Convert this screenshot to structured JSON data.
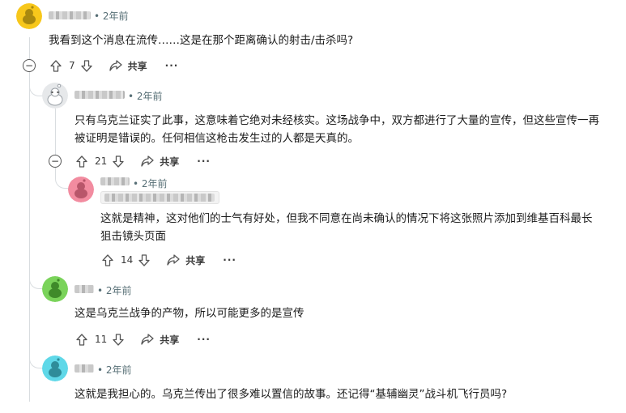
{
  "comments": [
    {
      "time": "2年前",
      "text": "我看到这个消息在流传……这是在那个距离确认的射击/击杀吗?",
      "votes": "7",
      "share": "共享",
      "avatar_color": "#f7c71b"
    },
    {
      "time": "2年前",
      "text": "只有乌克兰证实了此事，这意味着它绝对未经核实。这场战争中，双方都进行了大量的宣传，但这些宣传一再被证明是错误的。任何相信这枪击发生过的人都是天真的。",
      "votes": "21",
      "share": "共享",
      "avatar_color": "#d6d9dc"
    },
    {
      "time": "2年前",
      "text": "这就是精神，这对他们的士气有好处，但我不同意在尚未确认的情况下将这张照片添加到维基百科最长狙击镜头页面",
      "votes": "14",
      "share": "共享",
      "avatar_color": "#f28ca0"
    },
    {
      "time": "2年前",
      "text": "这是乌克兰战争的产物，所以可能更多的是宣传",
      "votes": "11",
      "share": "共享",
      "avatar_color": "#7ad35a"
    },
    {
      "time": "2年前",
      "text": "这就是我担心的。乌克兰传出了很多难以置信的故事。还记得“基辅幽灵”战斗机飞行员吗?",
      "avatar_color": "#5fd8e8"
    }
  ],
  "collapse_symbol": "−",
  "more_symbol": "···",
  "separator": "•"
}
